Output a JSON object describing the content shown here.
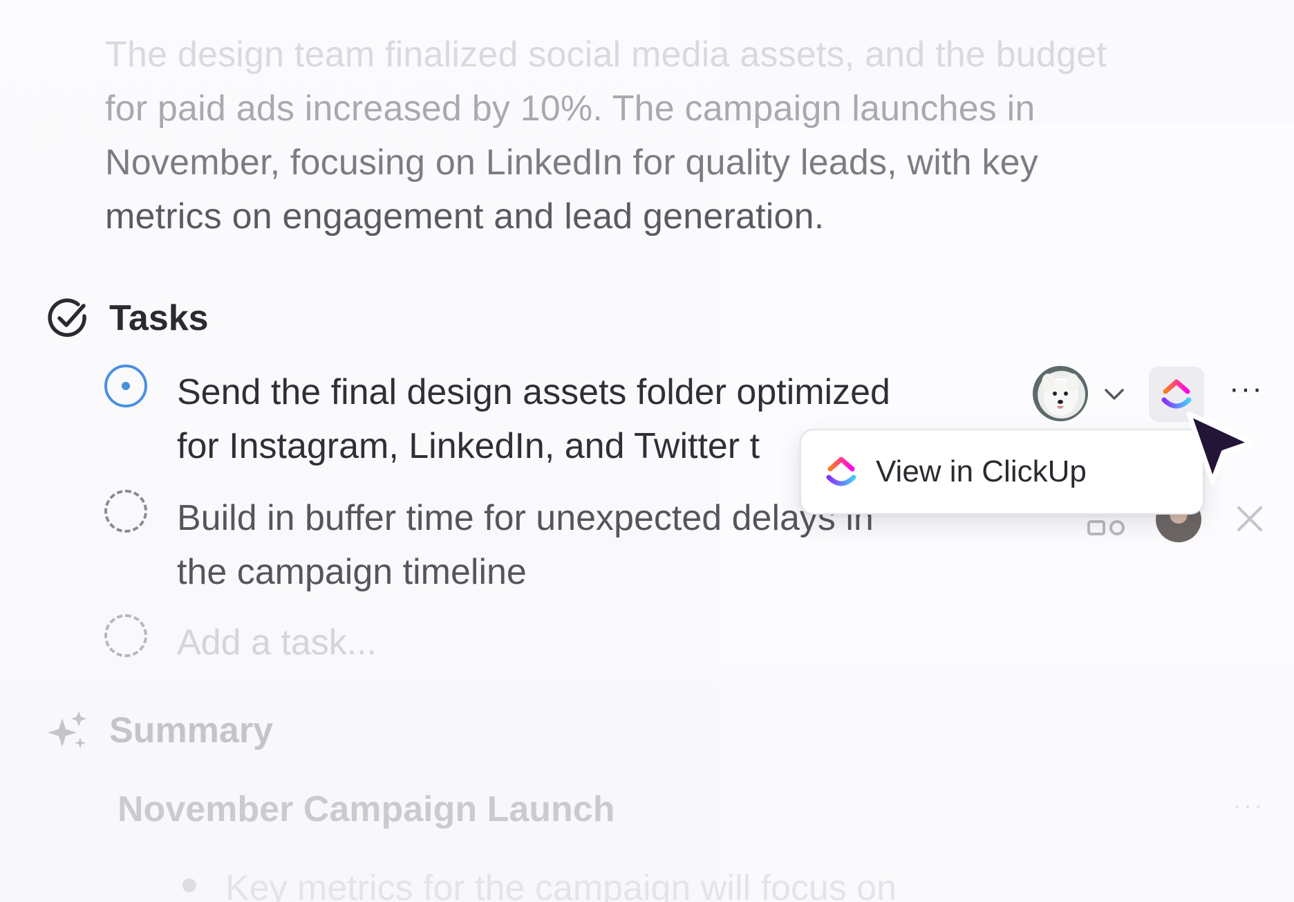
{
  "intro": {
    "lines": [
      "The design team finalized social media assets, and the budget",
      "for paid ads increased by 10%. The campaign launches in",
      "November, focusing on LinkedIn for quality leads, with key",
      "metrics on engagement and lead generation."
    ]
  },
  "tasks_section": {
    "title": "Tasks",
    "icon": "check-circle-icon",
    "items": [
      {
        "lines": [
          "Send the final design assets folder optimized",
          "for Instagram, LinkedIn, and Twitter t"
        ],
        "status": "in-progress",
        "assignee_icon": "avatar-dog",
        "more_label": "···"
      },
      {
        "lines": [
          "Build in buffer time for unexpected delays in",
          "the campaign timeline"
        ],
        "status": "open",
        "assignee_icon": "avatar-man"
      }
    ],
    "add_placeholder": "Add a task..."
  },
  "tooltip": {
    "label": "View in ClickUp",
    "icon": "clickup-logo-icon"
  },
  "summary_section": {
    "title": "Summary",
    "icon": "sparkle-icon",
    "subtitle": "November Campaign Launch",
    "more_label": "···",
    "bullets": [
      "Key metrics for the campaign will focus on"
    ]
  },
  "colors": {
    "accent_blue": "#4a90e2",
    "clickup_pink": "#ff02f0",
    "clickup_purple": "#8930fd",
    "clickup_yellow": "#ffc800",
    "clickup_orange": "#fa7d1e",
    "cursor_fill": "#231538"
  }
}
